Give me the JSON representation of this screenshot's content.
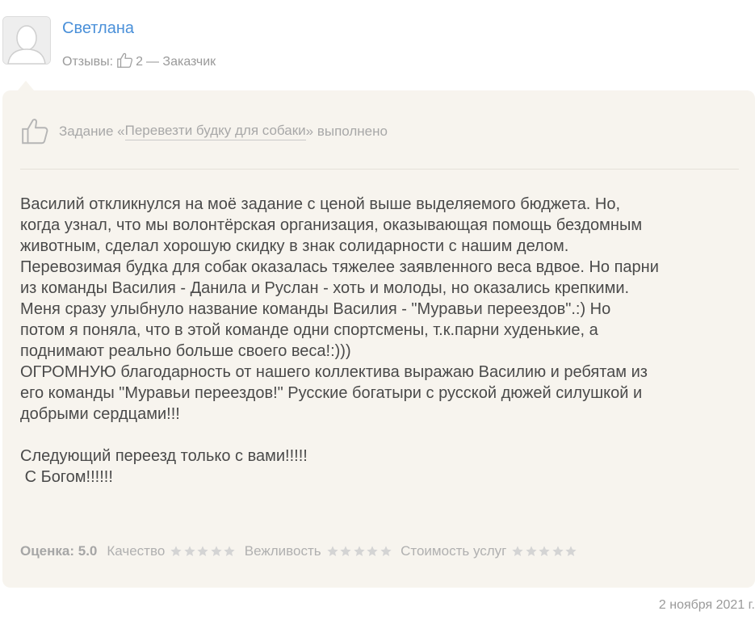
{
  "author": {
    "name": "Светлана",
    "reviews_label": "Отзывы:",
    "reviews_count": "2",
    "role": "— Заказчик"
  },
  "task": {
    "prefix": "Задание «",
    "link_text": "Перевезти будку для собаки",
    "suffix": "» выполнено"
  },
  "review": {
    "text": "Василий откликнулся на моё задание с ценой выше выделяемого бюджета. Но,\nкогда узнал, что мы волонтёрская организация, оказывающая помощь бездомным\nживотным, сделал хорошую скидку в знак солидарности с нашим делом.\nПеревозимая будка для собак оказалась тяжелее заявленного веса вдвое. Но парни\nиз команды Василия - Данила и Руслан - хоть и молоды, но оказались крепкими.\nМеня сразу улыбнуло название команды Василия - \"Муравьи переездов\".:) Но\nпотом я поняла, что в этой команде одни спортсмены, т.к.парни худенькие, а\nподнимают реально больше своего веса!:)))\nОГРОМНУЮ благодарность от нашего коллектива выражаю Василию и ребятам из\nего команды \"Муравьи переездов!\" Русские богатыри с русской дюжей силушкой и\nдобрыми сердцами!!!\n\nСледующий переезд только с вами!!!!!\n С Богом!!!!!!"
  },
  "rating": {
    "label": "Оценка: 5.0",
    "criteria": [
      {
        "name": "Качество",
        "stars": 5
      },
      {
        "name": "Вежливость",
        "stars": 5
      },
      {
        "name": "Стоимость услуг",
        "stars": 5
      }
    ]
  },
  "date": "2 ноября 2021 г.",
  "colors": {
    "accent_link": "#4a90d9",
    "card_background": "#f7f4ee",
    "muted_text": "#9a9a9a",
    "star": "#d4d4d4"
  },
  "icons": {
    "thumb": "thumbs-up-icon",
    "star": "star-icon",
    "avatar": "user-silhouette-icon"
  }
}
